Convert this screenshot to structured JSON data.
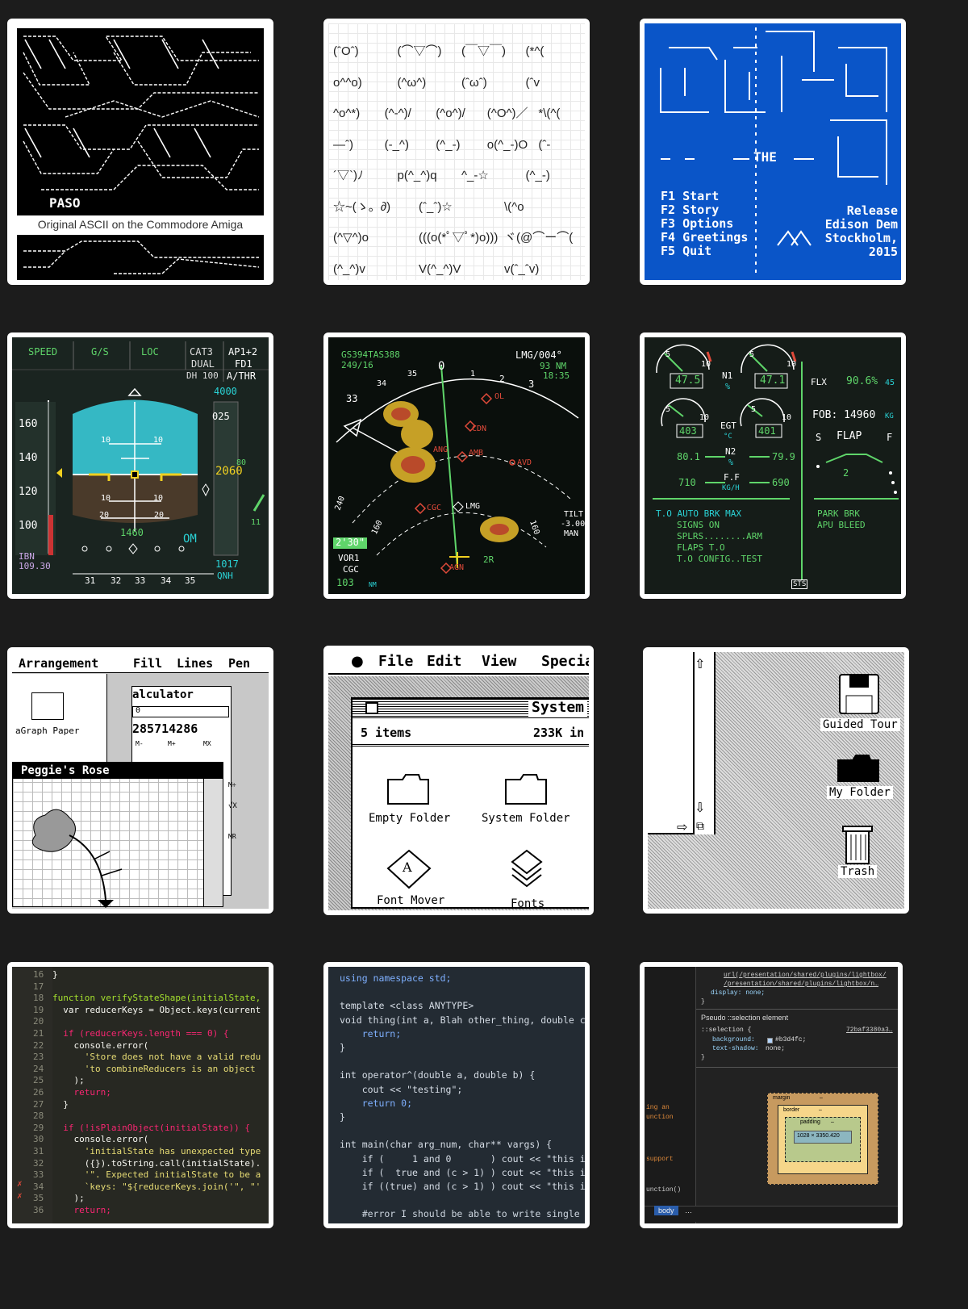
{
  "tiles": {
    "amiga": {
      "logo_label": "PASO",
      "caption": "Original ASCII on the Commodore Amiga"
    },
    "emoticons": {
      "rows": [
        [
          "(ˆOˆ)",
          "(⌒▽⌒)",
          "(￣▽￣)",
          "(*^("
        ],
        [
          "o^^o)",
          "(^ω^)",
          "(ˆωˆ)",
          "(ˆv"
        ],
        [
          "^o^*)",
          "(^-^)/",
          "(^o^)/",
          "(^O^)／",
          "*\\(^("
        ],
        [
          "—ˆ)",
          "(-_^)",
          "(^_-)",
          "o(^_-)O",
          "(ˆ-"
        ],
        [
          "´▽`)ﾉ",
          "p(^_^)q",
          "^_-☆",
          "(^_-)"
        ],
        [
          "☆~(ゝ。∂)",
          "(ˆ_ˆ)☆",
          "\\(^o"
        ],
        [
          "(^▽^)o",
          "(((o(*ﾟ▽ﾟ*)o)))",
          "ヾ(@⌒ー⌒("
        ],
        [
          "(^_^)v",
          "V(^_^)V",
          "v(ˆ_ˆv)"
        ]
      ]
    },
    "cbm_demo": {
      "the_label": "THE",
      "menu": [
        "F1 Start",
        "F2 Story",
        "F3 Options",
        "F4 Greetings",
        "F5 Quit"
      ],
      "release_lines": [
        "Release",
        "Edison Dem",
        "Stockholm,",
        "2015"
      ]
    },
    "pfd": {
      "top_labels": [
        "SPEED",
        "G/S",
        "LOC",
        "CAT3",
        "DUAL",
        "DH 100",
        "AP1+2",
        "FD1",
        "A/THR"
      ],
      "speeds": [
        "160",
        "140",
        "120",
        "100"
      ],
      "alt_top": "4000",
      "alt_025": "025",
      "alt_2060": "2060",
      "alt_80": "80",
      "pitch_10": "10",
      "pitch_20": "20",
      "bottom_value": "1460",
      "om": "OM",
      "ils_label": "IBN",
      "ils_freq": "109.30",
      "baro": "1017",
      "baro_unit": "QNH",
      "heading": [
        "31",
        "32",
        "33",
        "34",
        "35"
      ],
      "vs_label": "11"
    },
    "nd": {
      "gs_line": "GS394TAS388",
      "wind_line": "249/16",
      "dest_line": "LMG/004°",
      "dist_line": "93 NM",
      "time_line": "18:35",
      "ranges": [
        "160",
        "240",
        "160"
      ],
      "waypoints": [
        "OL",
        "CDN",
        "ANG",
        "AMB",
        "AVD",
        "CGC",
        "LMG",
        "2R",
        "AGN"
      ],
      "heading_ticks": [
        "33",
        "34",
        "35",
        "0",
        "1",
        "2",
        "3"
      ],
      "tilt": [
        "TILT",
        "-3.00",
        "MAN"
      ],
      "vor_label": "VOR1",
      "vor_id": "CGC",
      "vor_dist": "103",
      "vor_unit": "NM",
      "time_box": "2'30\""
    },
    "ecam": {
      "n1_left": "47.5",
      "n1_right": "47.1",
      "n1_label": "N1",
      "n1_unit": "%",
      "egt_left": "403",
      "egt_right": "401",
      "egt_label": "EGT",
      "egt_unit": "°C",
      "n2_left": "80.1",
      "n2_right": "79.9",
      "n2_label": "N2",
      "n2_unit": "%",
      "ff_left": "710",
      "ff_right": "690",
      "ff_label": "F.F",
      "ff_unit": "KG/H",
      "flx_label": "FLX",
      "flx_value": "90.6%",
      "flx_temp": "45",
      "fob": "FOB: 14960",
      "fob_unit": "KG",
      "flap_s": "S",
      "flap_label": "FLAP",
      "flap_f": "F",
      "flap_pos": "2",
      "memo_left": [
        "T.O AUTO BRK MAX",
        "SIGNS ON",
        "SPLRS........ARM",
        "FLAPS T.O",
        "T.O CONFIG..TEST"
      ],
      "memo_right": [
        "PARK BRK",
        "APU BLEED"
      ],
      "sts": "STS",
      "gauge_ticks": [
        "5",
        "10"
      ]
    },
    "macpaint": {
      "menu": [
        "Arrangement",
        "Fill",
        "Lines",
        "Pen"
      ],
      "calc_title": "alculator",
      "calc_display": "0",
      "calc_value": "285714286",
      "calc_keys": [
        "M-",
        "M+",
        "MX",
        "M÷",
        "√X",
        "MR"
      ],
      "graph_label": "aGraph Paper",
      "window_title": "Peggie's Rose"
    },
    "finder": {
      "menu": [
        "File",
        "Edit",
        "View",
        "Specia"
      ],
      "window_title": "System",
      "items_count": "5 items",
      "size": "233K in",
      "icons": [
        "Empty Folder",
        "System Folder",
        "Font Mover",
        "Fonts"
      ]
    },
    "desktop": {
      "icons": [
        "Guided Tour",
        "My Folder",
        "Trash"
      ]
    },
    "js_code": {
      "lines": [
        {
          "n": "16",
          "code": "}"
        },
        {
          "n": "17",
          "code": ""
        },
        {
          "n": "18",
          "code": "function verifyStateShape(initialState,"
        },
        {
          "n": "19",
          "code": "  var reducerKeys = Object.keys(current"
        },
        {
          "n": "20",
          "code": ""
        },
        {
          "n": "21",
          "code": "  if (reducerKeys.length === 0) {"
        },
        {
          "n": "22",
          "code": "    console.error("
        },
        {
          "n": "23",
          "code": "      'Store does not have a valid redu"
        },
        {
          "n": "24",
          "code": "      'to combineReducers is an object"
        },
        {
          "n": "25",
          "code": "    );"
        },
        {
          "n": "26",
          "code": "    return;"
        },
        {
          "n": "27",
          "code": "  }"
        },
        {
          "n": "28",
          "code": ""
        },
        {
          "n": "29",
          "code": "  if (!isPlainObject(initialState)) {"
        },
        {
          "n": "30",
          "code": "    console.error("
        },
        {
          "n": "31",
          "code": "      'initialState has unexpected type"
        },
        {
          "n": "32",
          "code": "      ({}).toString.call(initialState)."
        },
        {
          "n": "33",
          "code": "      '\". Expected initialState to be a"
        },
        {
          "n": "34",
          "code": "      `keys: \"${reducerKeys.join('\", \"'"
        },
        {
          "n": "35",
          "code": "    );"
        },
        {
          "n": "36",
          "code": "    return;"
        }
      ]
    },
    "cpp_code": {
      "lines": [
        "using namespace std;",
        "",
        "template <class ANYTYPE>",
        "void thing(int a, Blah other_thing, double c",
        "    return;",
        "}",
        "",
        "int operator^(double a, double b) {",
        "    cout << \"testing\";",
        "    return 0;",
        "}",
        "",
        "int main(char arg_num, char** vargs) {",
        "    if (     1 and 0       ) cout << \"this i",
        "    if (  true and (c > 1) ) cout << \"this i",
        "    if ((true) and (c > 1) ) cout << \"this i",
        "",
        "    #error I should be able to write single"
      ]
    },
    "devtools": {
      "url_line1": "url(/presentation/shared/plugins/lightbox/",
      "url_line2": "/presentation/shared/plugins/lightbox/n…",
      "display_line": "display: none;",
      "close_brace": "}",
      "section_title": "Pseudo ::selection element",
      "selector": "::selection {",
      "source": "72baf3380a3…",
      "bg_prop": "background:",
      "bg_value": "#b3d4fc;",
      "ts_prop": "text-shadow:",
      "ts_value": "none;",
      "box_margin": "margin",
      "box_border": "border",
      "box_padding": "padding",
      "box_content": "1028 × 3350.420",
      "dash": "–",
      "left_snippets": [
        "ing an",
        "unction",
        "support",
        "unction()"
      ],
      "crumb_body": "body",
      "crumb_more": "…"
    }
  }
}
